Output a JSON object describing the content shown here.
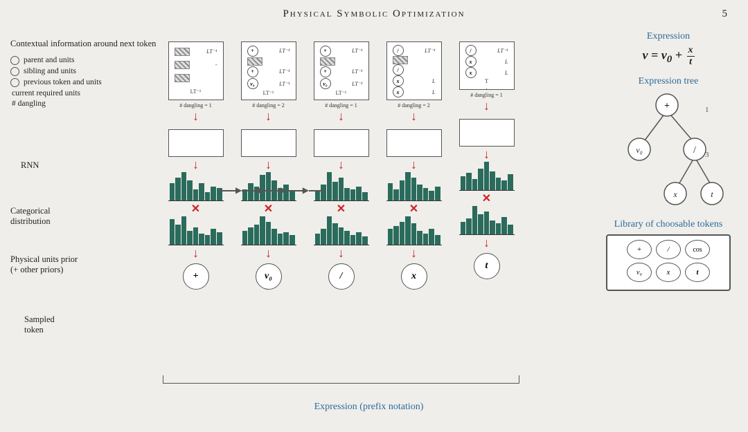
{
  "header": {
    "title": "Physical Symbolic Optimization",
    "page": "5"
  },
  "left_panel": {
    "context_title": "Contextual information around next token",
    "items": [
      {
        "type": "radio",
        "label": "parent and units"
      },
      {
        "type": "radio",
        "label": "sibling and units"
      },
      {
        "type": "radio",
        "label": "previous token and units"
      },
      {
        "type": "plain",
        "label": "current required units"
      },
      {
        "type": "plain",
        "label": "# dangling"
      }
    ],
    "rnn_label": "RNN",
    "cat_label": "Categorical\ndistribution",
    "phys_label": "Physical units prior\n(+ other priors)",
    "sampled_label": "Sampled\ntoken"
  },
  "columns": [
    {
      "token": "+",
      "dangling": "# dangling = 1",
      "rows": [
        {
          "symbol": "÷",
          "unit": "LT⁻¹"
        },
        {
          "symbol": "—",
          "unit": ""
        },
        {
          "symbol": "÷",
          "unit": ""
        },
        {
          "symbol": "",
          "unit": "LT⁻¹"
        }
      ]
    },
    {
      "token": "v₀",
      "dangling": "# dangling = 2",
      "rows": [
        {
          "symbol": "+",
          "unit": "LT⁻¹"
        },
        {
          "symbol": "÷",
          "unit": ""
        },
        {
          "symbol": "+",
          "unit": "LT⁻¹"
        },
        {
          "symbol": "v₀",
          "unit": "LT⁻¹"
        },
        {
          "symbol": "",
          "unit": "LT⁻¹"
        }
      ]
    },
    {
      "token": "/",
      "dangling": "# dangling = 1",
      "rows": [
        {
          "symbol": "+",
          "unit": "LT⁻¹"
        },
        {
          "symbol": "÷",
          "unit": ""
        },
        {
          "symbol": "+",
          "unit": "LT⁻¹"
        },
        {
          "symbol": "v₀",
          "unit": "LT⁻¹"
        },
        {
          "symbol": "",
          "unit": "LT⁻¹"
        }
      ]
    },
    {
      "token": "x",
      "dangling": "# dangling = 2",
      "rows": [
        {
          "symbol": "/",
          "unit": "LT⁻¹"
        },
        {
          "symbol": "—",
          "unit": ""
        },
        {
          "symbol": "/",
          "unit": ""
        },
        {
          "symbol": "x",
          "unit": "L"
        },
        {
          "symbol": "x",
          "unit": "L"
        }
      ]
    },
    {
      "token": "t",
      "dangling": "# dangling = 1",
      "rows": [
        {
          "symbol": "/",
          "unit": "LT⁻¹"
        },
        {
          "symbol": "x",
          "unit": "L"
        },
        {
          "symbol": "x",
          "unit": "L"
        },
        {
          "symbol": "",
          "unit": "T"
        }
      ]
    }
  ],
  "right_panel": {
    "expression_title": "Expression",
    "expression": "v = v₀ + x/t",
    "tree_title": "Expression tree",
    "library_title": "Library of choosable tokens",
    "library": [
      [
        "+",
        "/",
        "cos"
      ],
      [
        "v₀",
        "x",
        "t"
      ]
    ]
  },
  "bottom_label": "Expression (prefix notation)"
}
